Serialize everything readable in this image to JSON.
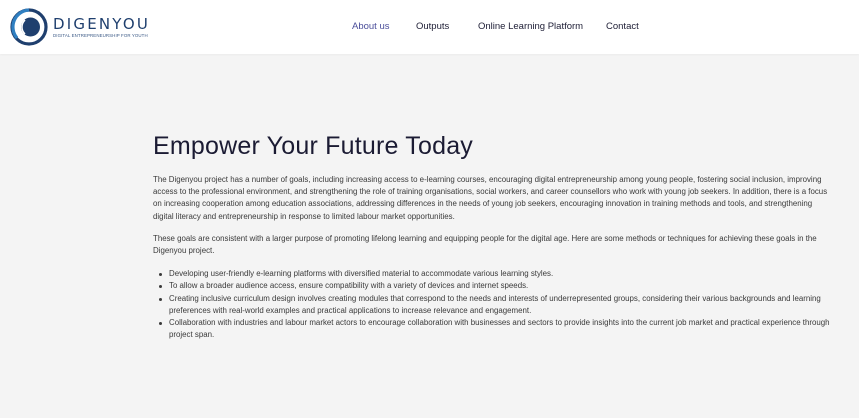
{
  "brand": {
    "name": "DIGENYOU",
    "tagline": "DIGITAL ENTREPRENEURSHIP FOR YOUTH",
    "colors": {
      "primary": "#1f3f6e",
      "accent": "#2f7fc1"
    }
  },
  "nav": {
    "items": [
      {
        "label": "About us",
        "active": true
      },
      {
        "label": "Outputs",
        "active": false
      },
      {
        "label": "Online Learning Platform",
        "active": false
      },
      {
        "label": "Contact",
        "active": false
      }
    ]
  },
  "content": {
    "title": "Empower Your Future Today",
    "paragraphs": [
      "The Digenyou project has a number of goals, including increasing access to e-learning courses, encouraging digital entrepreneurship among young people, fostering social inclusion, improving access to the professional environment, and strengthening the role of training organisations, social workers, and career counsellors who work with young job seekers. In addition, there is a focus on increasing cooperation among education associations, addressing differences in the needs of young job seekers, encouraging innovation in training methods and tools, and strengthening digital literacy and entrepreneurship in response to limited labour market opportunities.",
      "These goals are consistent with a larger purpose of promoting lifelong learning and equipping people for the digital age. Here are some methods or techniques for achieving these goals in the Digenyou project."
    ],
    "bullets": [
      "Developing user-friendly e-learning platforms with diversified material to accommodate various learning styles.",
      "To allow a broader audience access, ensure compatibility with a variety of devices and internet speeds.",
      "Creating inclusive curriculum design involves creating modules that correspond to the needs and interests of underrepresented groups, considering their various backgrounds and learning preferences with real-world examples and practical applications to increase relevance and engagement.",
      "Collaboration with industries and labour market actors to encourage collaboration with businesses and sectors to provide insights into the current job market and practical experience through project span."
    ]
  }
}
